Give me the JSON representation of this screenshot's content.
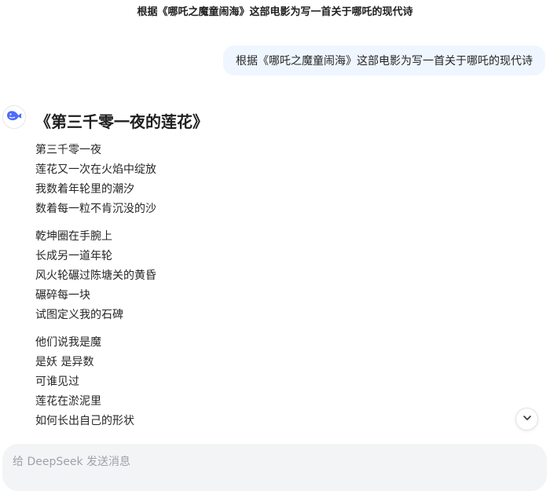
{
  "header": {
    "title": "根据《哪吒之魔童闹海》这部电影为写一首关于哪吒的现代诗"
  },
  "user_message": {
    "text": "根据《哪吒之魔童闹海》这部电影为写一首关于哪吒的现代诗"
  },
  "assistant": {
    "avatar_icon": "deepseek-whale-icon",
    "poem_title": "《第三千零一夜的莲花》",
    "stanzas": [
      [
        "第三千零一夜",
        "莲花又一次在火焰中绽放",
        "我数着年轮里的潮汐",
        "数着每一粒不肯沉没的沙"
      ],
      [
        "乾坤圈在手腕上",
        "长成另一道年轮",
        "风火轮碾过陈塘关的黄昏",
        "碾碎每一块",
        "试图定义我的石碑"
      ],
      [
        "他们说我是魔",
        "是妖 是异数",
        "可谁见过",
        "莲花在淤泥里",
        "如何长出自己的形状"
      ]
    ]
  },
  "input": {
    "placeholder": "给 DeepSeek 发送消息"
  },
  "colors": {
    "accent": "#4d6bfe",
    "user_bubble_bg": "#eff6ff",
    "input_bg": "#f3f4f6"
  }
}
